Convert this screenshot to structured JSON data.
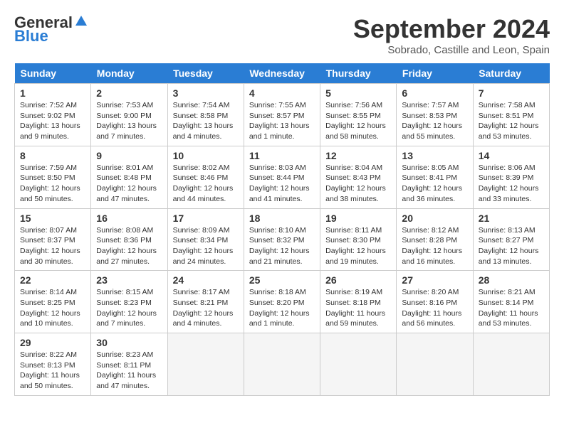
{
  "header": {
    "logo_general": "General",
    "logo_blue": "Blue",
    "title": "September 2024",
    "subtitle": "Sobrado, Castille and Leon, Spain"
  },
  "days_of_week": [
    "Sunday",
    "Monday",
    "Tuesday",
    "Wednesday",
    "Thursday",
    "Friday",
    "Saturday"
  ],
  "weeks": [
    [
      {
        "day": 1,
        "lines": [
          "Sunrise: 7:52 AM",
          "Sunset: 9:02 PM",
          "Daylight: 13 hours",
          "and 9 minutes."
        ]
      },
      {
        "day": 2,
        "lines": [
          "Sunrise: 7:53 AM",
          "Sunset: 9:00 PM",
          "Daylight: 13 hours",
          "and 7 minutes."
        ]
      },
      {
        "day": 3,
        "lines": [
          "Sunrise: 7:54 AM",
          "Sunset: 8:58 PM",
          "Daylight: 13 hours",
          "and 4 minutes."
        ]
      },
      {
        "day": 4,
        "lines": [
          "Sunrise: 7:55 AM",
          "Sunset: 8:57 PM",
          "Daylight: 13 hours",
          "and 1 minute."
        ]
      },
      {
        "day": 5,
        "lines": [
          "Sunrise: 7:56 AM",
          "Sunset: 8:55 PM",
          "Daylight: 12 hours",
          "and 58 minutes."
        ]
      },
      {
        "day": 6,
        "lines": [
          "Sunrise: 7:57 AM",
          "Sunset: 8:53 PM",
          "Daylight: 12 hours",
          "and 55 minutes."
        ]
      },
      {
        "day": 7,
        "lines": [
          "Sunrise: 7:58 AM",
          "Sunset: 8:51 PM",
          "Daylight: 12 hours",
          "and 53 minutes."
        ]
      }
    ],
    [
      {
        "day": 8,
        "lines": [
          "Sunrise: 7:59 AM",
          "Sunset: 8:50 PM",
          "Daylight: 12 hours",
          "and 50 minutes."
        ]
      },
      {
        "day": 9,
        "lines": [
          "Sunrise: 8:01 AM",
          "Sunset: 8:48 PM",
          "Daylight: 12 hours",
          "and 47 minutes."
        ]
      },
      {
        "day": 10,
        "lines": [
          "Sunrise: 8:02 AM",
          "Sunset: 8:46 PM",
          "Daylight: 12 hours",
          "and 44 minutes."
        ]
      },
      {
        "day": 11,
        "lines": [
          "Sunrise: 8:03 AM",
          "Sunset: 8:44 PM",
          "Daylight: 12 hours",
          "and 41 minutes."
        ]
      },
      {
        "day": 12,
        "lines": [
          "Sunrise: 8:04 AM",
          "Sunset: 8:43 PM",
          "Daylight: 12 hours",
          "and 38 minutes."
        ]
      },
      {
        "day": 13,
        "lines": [
          "Sunrise: 8:05 AM",
          "Sunset: 8:41 PM",
          "Daylight: 12 hours",
          "and 36 minutes."
        ]
      },
      {
        "day": 14,
        "lines": [
          "Sunrise: 8:06 AM",
          "Sunset: 8:39 PM",
          "Daylight: 12 hours",
          "and 33 minutes."
        ]
      }
    ],
    [
      {
        "day": 15,
        "lines": [
          "Sunrise: 8:07 AM",
          "Sunset: 8:37 PM",
          "Daylight: 12 hours",
          "and 30 minutes."
        ]
      },
      {
        "day": 16,
        "lines": [
          "Sunrise: 8:08 AM",
          "Sunset: 8:36 PM",
          "Daylight: 12 hours",
          "and 27 minutes."
        ]
      },
      {
        "day": 17,
        "lines": [
          "Sunrise: 8:09 AM",
          "Sunset: 8:34 PM",
          "Daylight: 12 hours",
          "and 24 minutes."
        ]
      },
      {
        "day": 18,
        "lines": [
          "Sunrise: 8:10 AM",
          "Sunset: 8:32 PM",
          "Daylight: 12 hours",
          "and 21 minutes."
        ]
      },
      {
        "day": 19,
        "lines": [
          "Sunrise: 8:11 AM",
          "Sunset: 8:30 PM",
          "Daylight: 12 hours",
          "and 19 minutes."
        ]
      },
      {
        "day": 20,
        "lines": [
          "Sunrise: 8:12 AM",
          "Sunset: 8:28 PM",
          "Daylight: 12 hours",
          "and 16 minutes."
        ]
      },
      {
        "day": 21,
        "lines": [
          "Sunrise: 8:13 AM",
          "Sunset: 8:27 PM",
          "Daylight: 12 hours",
          "and 13 minutes."
        ]
      }
    ],
    [
      {
        "day": 22,
        "lines": [
          "Sunrise: 8:14 AM",
          "Sunset: 8:25 PM",
          "Daylight: 12 hours",
          "and 10 minutes."
        ]
      },
      {
        "day": 23,
        "lines": [
          "Sunrise: 8:15 AM",
          "Sunset: 8:23 PM",
          "Daylight: 12 hours",
          "and 7 minutes."
        ]
      },
      {
        "day": 24,
        "lines": [
          "Sunrise: 8:17 AM",
          "Sunset: 8:21 PM",
          "Daylight: 12 hours",
          "and 4 minutes."
        ]
      },
      {
        "day": 25,
        "lines": [
          "Sunrise: 8:18 AM",
          "Sunset: 8:20 PM",
          "Daylight: 12 hours",
          "and 1 minute."
        ]
      },
      {
        "day": 26,
        "lines": [
          "Sunrise: 8:19 AM",
          "Sunset: 8:18 PM",
          "Daylight: 11 hours",
          "and 59 minutes."
        ]
      },
      {
        "day": 27,
        "lines": [
          "Sunrise: 8:20 AM",
          "Sunset: 8:16 PM",
          "Daylight: 11 hours",
          "and 56 minutes."
        ]
      },
      {
        "day": 28,
        "lines": [
          "Sunrise: 8:21 AM",
          "Sunset: 8:14 PM",
          "Daylight: 11 hours",
          "and 53 minutes."
        ]
      }
    ],
    [
      {
        "day": 29,
        "lines": [
          "Sunrise: 8:22 AM",
          "Sunset: 8:13 PM",
          "Daylight: 11 hours",
          "and 50 minutes."
        ]
      },
      {
        "day": 30,
        "lines": [
          "Sunrise: 8:23 AM",
          "Sunset: 8:11 PM",
          "Daylight: 11 hours",
          "and 47 minutes."
        ]
      },
      null,
      null,
      null,
      null,
      null
    ]
  ]
}
